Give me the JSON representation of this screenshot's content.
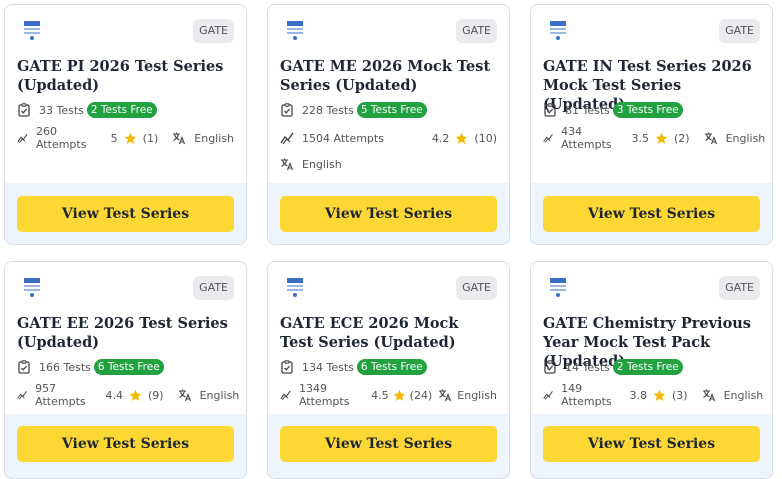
{
  "cards": [
    {
      "badge": "GATE",
      "title": "GATE PI 2026 Test Series (Updated)",
      "tests": "33 Tests",
      "free": "2 Tests Free",
      "attempts": "260 Attempts",
      "rating": "5",
      "reviews": "(1)",
      "language": "English",
      "button": "View Test Series"
    },
    {
      "badge": "GATE",
      "title": "GATE ME 2026 Mock Test Series (Updated)",
      "tests": "228 Tests",
      "free": "5 Tests Free",
      "attempts": "1504 Attempts",
      "rating": "4.2",
      "reviews": "(10)",
      "language": "English",
      "button": "View Test Series"
    },
    {
      "badge": "GATE",
      "title": "GATE IN Test Series 2026 Mock Test Series (Updated)",
      "tests": "81 Tests",
      "free": "3 Tests Free",
      "attempts": "434 Attempts",
      "rating": "3.5",
      "reviews": "(2)",
      "language": "English",
      "button": "View Test Series"
    },
    {
      "badge": "GATE",
      "title": "GATE EE 2026 Test Series (Updated)",
      "tests": "166 Tests",
      "free": "6 Tests Free",
      "attempts": "957 Attempts",
      "rating": "4.4",
      "reviews": "(9)",
      "language": "English",
      "button": "View Test Series"
    },
    {
      "badge": "GATE",
      "title": "GATE ECE 2026 Mock Test Series (Updated)",
      "tests": "134 Tests",
      "free": "6 Tests Free",
      "attempts": "1349 Attempts",
      "rating": "4.5",
      "reviews": "(24)",
      "language": "English",
      "button": "View Test Series"
    },
    {
      "badge": "GATE",
      "title": "GATE Chemistry Previous Year Mock Test Pack (Updated)",
      "tests": "14 Tests",
      "free": "2 Tests Free",
      "attempts": "149 Attempts",
      "rating": "3.8",
      "reviews": "(3)",
      "language": "English",
      "button": "View Test Series"
    }
  ],
  "colors": {
    "button": "#fdd835",
    "free_badge": "#21a23f",
    "star": "#f5b800",
    "card_bottom": "#eef4fb"
  },
  "icons": {
    "logo": "gate-logo",
    "tests": "clipboard-check-icon",
    "attempts": "trend-icon",
    "rating": "star-icon",
    "language": "translate-icon"
  }
}
